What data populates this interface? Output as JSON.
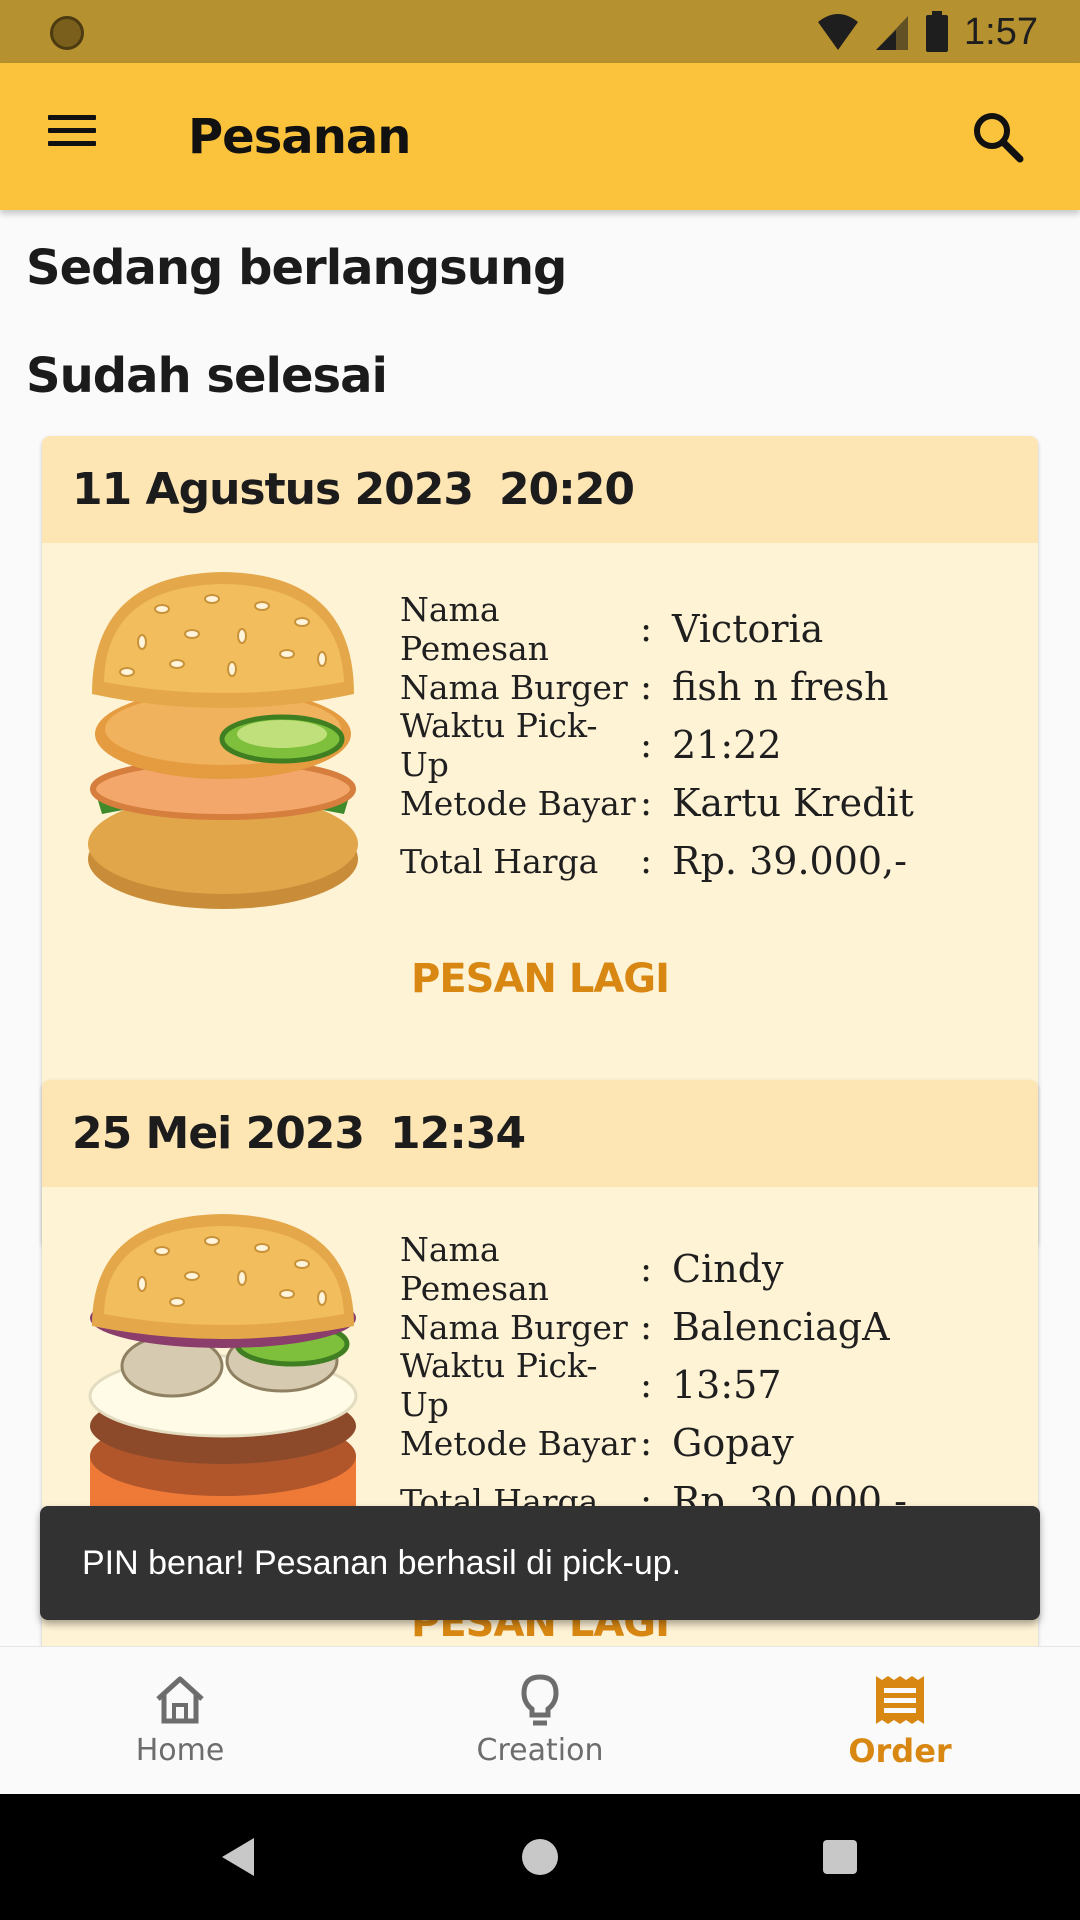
{
  "status_bar": {
    "time": "1:57"
  },
  "app_bar": {
    "title": "Pesanan"
  },
  "sections": {
    "ongoing": "Sedang berlangsung",
    "done": "Sudah selesai"
  },
  "labels": {
    "name": "Nama Pemesan",
    "burger": "Nama Burger",
    "pickup": "Waktu Pick-Up",
    "payment": "Metode Bayar",
    "total": "Total Harga",
    "colon": ":",
    "reorder": "PESAN LAGI"
  },
  "orders": [
    {
      "date": "11 Agustus 2023",
      "time": "20:20",
      "name": "Victoria",
      "burger": "fish n fresh",
      "pickup": "21:22",
      "payment": "Kartu Kredit",
      "total": "Rp. 39.000,-"
    },
    {
      "date": "25 Mei 2023",
      "time": "12:34",
      "name": "Cindy",
      "burger": "BalenciagA",
      "pickup": "13:57",
      "payment": "Gopay",
      "total": "Rp. 30.000,-"
    }
  ],
  "snackbar": {
    "message": "PIN benar! Pesanan berhasil di pick-up."
  },
  "bottom_nav": {
    "items": [
      {
        "label": "Home",
        "icon": "home-icon"
      },
      {
        "label": "Creation",
        "icon": "lightbulb-icon"
      },
      {
        "label": "Order",
        "icon": "receipt-icon",
        "active": true
      }
    ]
  },
  "colors": {
    "primary": "#fbc23c",
    "accent": "#d88712",
    "status_bar": "#b6912f",
    "card": "#fff3d6",
    "card_header": "#fde5b4"
  }
}
